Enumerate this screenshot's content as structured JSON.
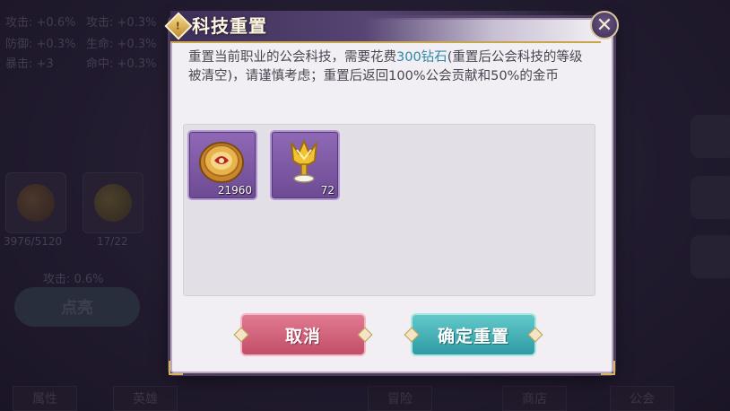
{
  "background": {
    "stats": [
      {
        "label": "攻击",
        "value": "+0.6%"
      },
      {
        "label": "攻击",
        "value": "+0.3%"
      },
      {
        "label": "防御",
        "value": "+0.3%"
      },
      {
        "label": "生命",
        "value": "+0.3%"
      },
      {
        "label": "暴击",
        "value": "+3"
      },
      {
        "label": "命中",
        "value": "+0.3%"
      }
    ],
    "card_counts": [
      "3976/5120",
      "17/22"
    ],
    "attack_text": "攻击: 0.6%",
    "light_button": "点亮",
    "tabs": [
      "属性",
      "英雄",
      "冒险",
      "商店",
      "公会"
    ]
  },
  "dialog": {
    "title": "科技重置",
    "title_badge": "!",
    "description_prefix": "重置当前职业的公会科技，需要花费",
    "description_highlight": "300钻石",
    "description_suffix": "(重置后公会科技的等级被清空)，请谨慎考虑；重置后返回100%公会贡献和50%的金币",
    "highlight_color": "#2e88a8",
    "items": [
      {
        "icon": "guild-coin-icon",
        "count": "21960"
      },
      {
        "icon": "golden-trophy-icon",
        "count": "72"
      }
    ],
    "cancel_label": "取消",
    "confirm_label": "确定重置"
  }
}
